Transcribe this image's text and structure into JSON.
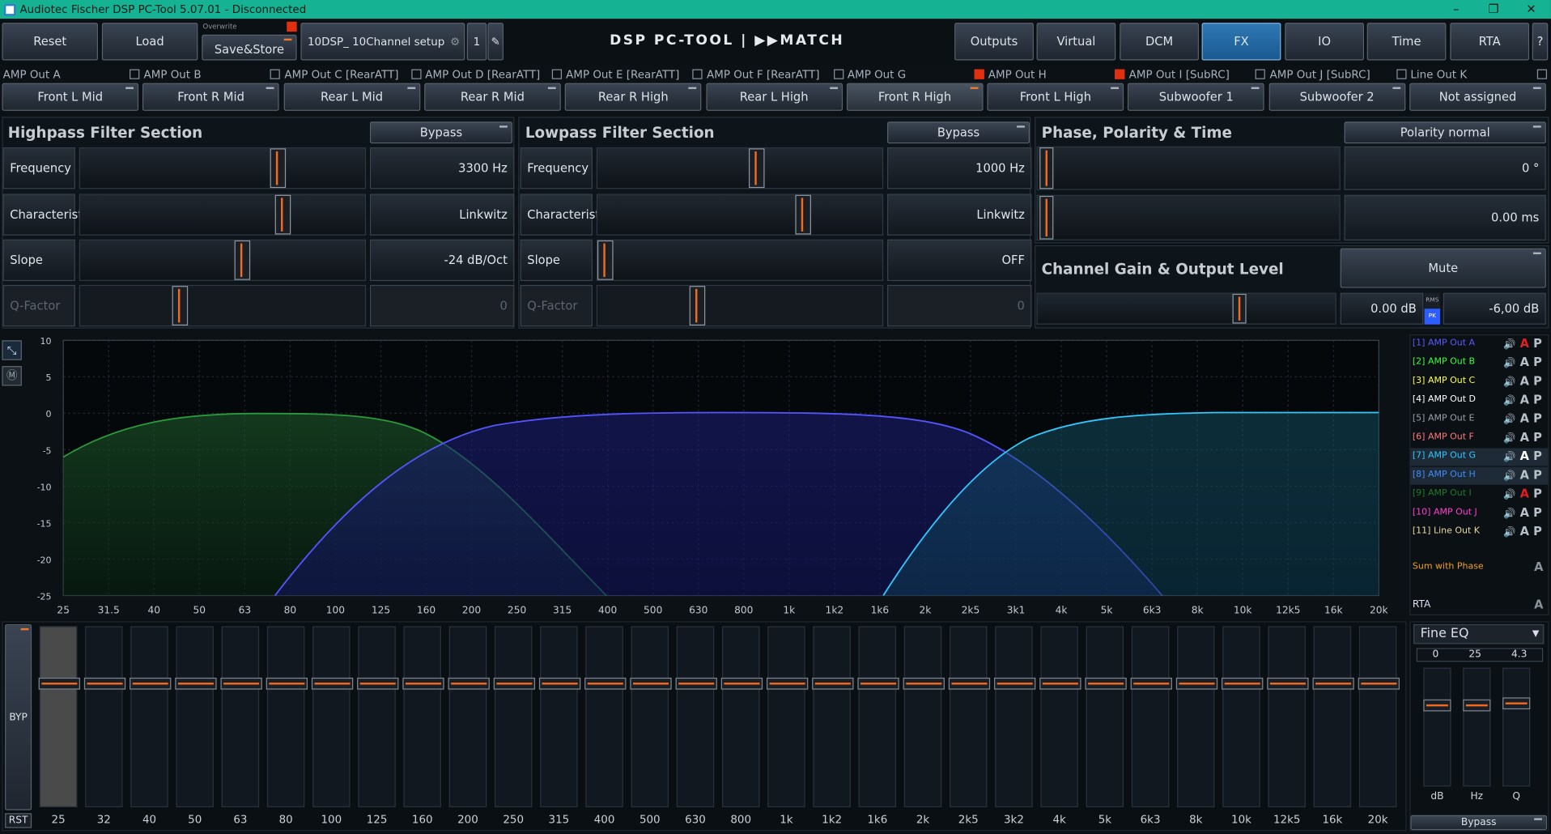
{
  "window": {
    "title": "Audiotec Fischer DSP PC-Tool 5.07.01 - Disconnected",
    "min": "–",
    "max": "❐",
    "close": "✕"
  },
  "toolbar": {
    "reset": "Reset",
    "load": "Load",
    "overwrite": "Overwrite",
    "save_store": "Save&Store",
    "setup_name": "10DSP_ 10Channel setup",
    "preset_num": "1",
    "logo": "DSP PC-TOOL | ▶▶MATCH"
  },
  "nav_tabs": [
    "Outputs",
    "Virtual",
    "DCM",
    "FX",
    "IO",
    "Time",
    "RTA",
    "?"
  ],
  "channels": [
    {
      "label": "AMP Out A",
      "name": "Front L Mid",
      "flag": false
    },
    {
      "label": "AMP Out B",
      "name": "Front R Mid",
      "flag": false
    },
    {
      "label": "AMP Out C [RearATT]",
      "name": "Rear L Mid",
      "flag": false
    },
    {
      "label": "AMP Out D [RearATT]",
      "name": "Rear R Mid",
      "flag": false
    },
    {
      "label": "AMP Out E [RearATT]",
      "name": "Rear R High",
      "flag": false
    },
    {
      "label": "AMP Out F [RearATT]",
      "name": "Rear L High",
      "flag": false
    },
    {
      "label": "AMP Out G",
      "name": "Front R High",
      "flag": true
    },
    {
      "label": "AMP Out H",
      "name": "Front L High",
      "flag": true
    },
    {
      "label": "AMP Out I [SubRC]",
      "name": "Subwoofer 1",
      "flag": false
    },
    {
      "label": "AMP Out J [SubRC]",
      "name": "Subwoofer 2",
      "flag": false
    },
    {
      "label": "Line Out K",
      "name": "Not assigned",
      "flag": false
    }
  ],
  "highpass": {
    "title": "Highpass Filter Section",
    "bypass": "Bypass",
    "rows": [
      {
        "label": "Frequency",
        "value": "3300 Hz",
        "pos": 0.7
      },
      {
        "label": "Characteristic",
        "value": "Linkwitz",
        "pos": 0.72
      },
      {
        "label": "Slope",
        "value": "-24 dB/Oct",
        "pos": 0.57
      },
      {
        "label": "Q-Factor",
        "value": "0",
        "pos": 0.34
      }
    ]
  },
  "lowpass": {
    "title": "Lowpass Filter Section",
    "bypass": "Bypass",
    "rows": [
      {
        "label": "Frequency",
        "value": "1000 Hz",
        "pos": 0.56
      },
      {
        "label": "Characteristic",
        "value": "Linkwitz",
        "pos": 0.73
      },
      {
        "label": "Slope",
        "value": "OFF",
        "pos": 0.0
      },
      {
        "label": "Q-Factor",
        "value": "0",
        "pos": 0.34
      }
    ]
  },
  "phase": {
    "title": "Phase, Polarity & Time",
    "polarity": "Polarity normal",
    "phase_value": "0 °",
    "time_value": "0.00 ms"
  },
  "gain": {
    "title": "Channel Gain & Output Level",
    "mute": "Mute",
    "gain_value": "0.00 dB",
    "rms": "RMS",
    "pk": "PK",
    "level_value": "-6,00 dB"
  },
  "graph": {
    "y_ticks": [
      "10",
      "5",
      "0",
      "-5",
      "-10",
      "-15",
      "-20",
      "-25"
    ],
    "x_ticks": [
      "25",
      "31.5",
      "40",
      "50",
      "63",
      "80",
      "100",
      "125",
      "160",
      "200",
      "250",
      "315",
      "400",
      "500",
      "630",
      "800",
      "1k",
      "1k2",
      "1k6",
      "2k",
      "2k5",
      "3k1",
      "4k",
      "5k",
      "6k3",
      "8k",
      "10k",
      "12k5",
      "16k",
      "20k"
    ]
  },
  "legend": [
    {
      "label": "[1] AMP Out A",
      "color": "#5a5aff",
      "a": "#e02020"
    },
    {
      "label": "[2] AMP Out B",
      "color": "#3cff3c",
      "a": "#b8c0c8"
    },
    {
      "label": "[3] AMP Out C",
      "color": "#ffff40",
      "a": "#b8c0c8"
    },
    {
      "label": "[4] AMP Out D",
      "color": "#ffffff",
      "a": "#b8c0c8"
    },
    {
      "label": "[5] AMP Out E",
      "color": "#9aa0a8",
      "a": "#b8c0c8"
    },
    {
      "label": "[6] AMP Out F",
      "color": "#ff7a7a",
      "a": "#b8c0c8"
    },
    {
      "label": "[7] AMP Out G",
      "color": "#30c8ff",
      "a": "#ffffff"
    },
    {
      "label": "[8] AMP Out H",
      "color": "#3c8cff",
      "a": "#b8c0c8"
    },
    {
      "label": "[9] AMP Out I",
      "color": "#1f7a2a",
      "a": "#e02020"
    },
    {
      "label": "[10] AMP Out J",
      "color": "#ff40d0",
      "a": "#b8c0c8"
    },
    {
      "label": "[11] Line Out K",
      "color": "#e8d8a0",
      "a": "#b8c0c8"
    }
  ],
  "sum_phase": "Sum with Phase",
  "rta": "RTA",
  "eq": {
    "byp": "BYP",
    "rst": "RST",
    "bands": [
      "25",
      "32",
      "40",
      "50",
      "63",
      "80",
      "100",
      "125",
      "160",
      "200",
      "250",
      "315",
      "400",
      "500",
      "630",
      "800",
      "1k",
      "1k2",
      "1k6",
      "2k",
      "2k5",
      "3k2",
      "4k",
      "5k",
      "6k3",
      "8k",
      "10k",
      "12k5",
      "16k",
      "20k"
    ]
  },
  "fine_eq": {
    "title": "Fine EQ",
    "db": "0",
    "hz": "25",
    "q": "4.3",
    "db_label": "dB",
    "hz_label": "Hz",
    "q_label": "Q",
    "bypass": "Bypass"
  },
  "colors": {
    "accent": "#ef6a22",
    "active_tab": "#1a5a91",
    "title_bar": "#15b393"
  }
}
